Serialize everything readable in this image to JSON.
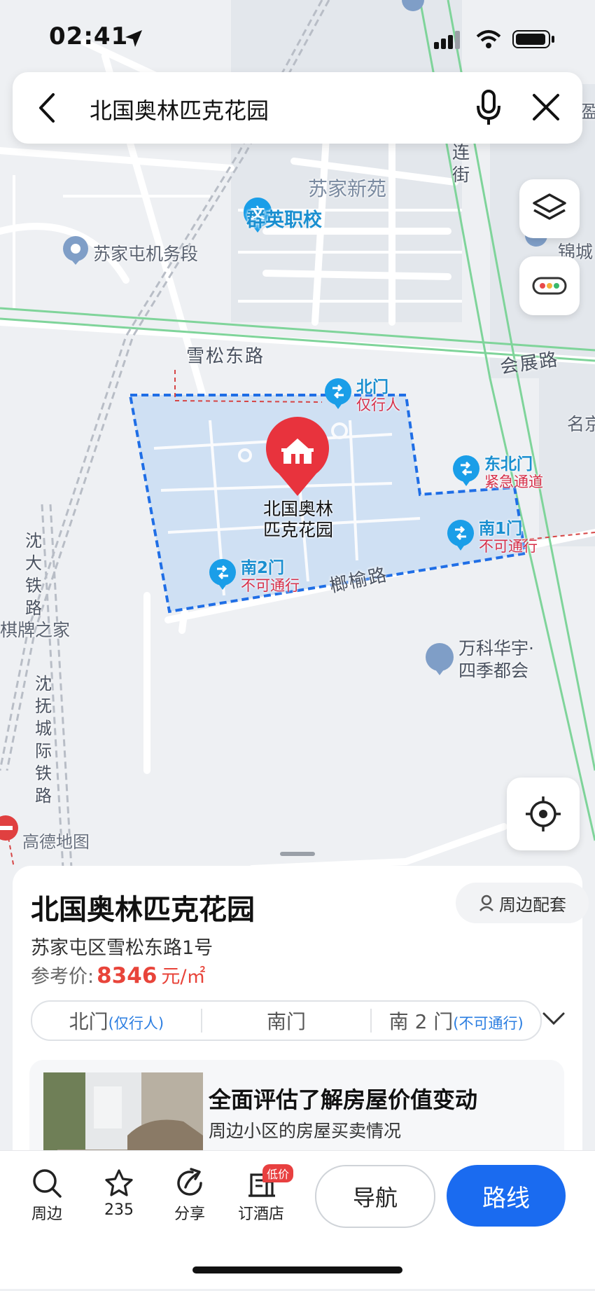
{
  "status_bar": {
    "time": "02:41"
  },
  "search": {
    "query": "北国奥林匹克花园"
  },
  "map": {
    "labels": {
      "sujia_xinyuan": "苏家新苑",
      "qunying": "群英职校",
      "jiwuduan": "苏家屯机务段",
      "xuesong_road": "雪松东路",
      "huizhan_road": "会展路",
      "yingjin_1": "盈",
      "yingjin_2": "锦城",
      "ying_top": "盈",
      "lian_street": "连\n街",
      "ming": "名京",
      "shenda_railway": "沈大铁路",
      "qipai": "棋牌之家",
      "shenfu_railway": "沈抚城际铁路",
      "yeyu_road": "榔榆路",
      "vanke": "万科华宇·四季都会",
      "gaode": "高德地图",
      "poi_name": "北国奥林匹克花园"
    },
    "gates": [
      {
        "name": "北门",
        "note": "仅行人"
      },
      {
        "name": "东北门",
        "note": "紧急通道"
      },
      {
        "name": "南1门",
        "note": "不可通行"
      },
      {
        "name": "南2门",
        "note": "不可通行"
      }
    ]
  },
  "sheet": {
    "title": "北国奥林匹克花园",
    "nearby_label": "周边配套",
    "address": "苏家屯区雪松东路1号",
    "price_label": "参考价:",
    "price_value": "8346",
    "price_unit": "元/㎡",
    "gate_tabs": [
      {
        "label": "北门",
        "note": "(仅行人)"
      },
      {
        "label": "南门",
        "note": ""
      },
      {
        "label": "南 2 门",
        "note": "(不可通行)"
      }
    ],
    "card": {
      "title": "全面评估了解房屋价值变动",
      "subtitle": "周边小区的房屋买卖情况"
    }
  },
  "bottom_bar": {
    "nearby": "周边",
    "favorites": "235",
    "share": "分享",
    "hotel": "订酒店",
    "hotel_badge": "低价",
    "navigate": "导航",
    "route": "路线"
  },
  "colors": {
    "accent": "#1a6bf0",
    "price": "#e8443a",
    "gate_text": "#1a8fd0",
    "gate_warn": "#d6304a",
    "area_fill": "#cfe0f3",
    "area_border": "#1f6ee6"
  }
}
